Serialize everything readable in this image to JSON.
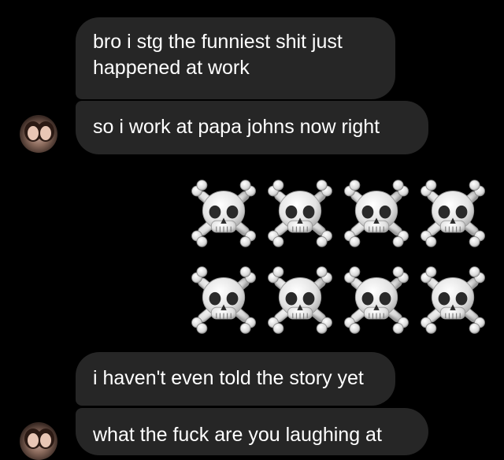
{
  "messages": [
    {
      "text": "bro i stg the funniest shit just\nhappened at work"
    },
    {
      "text": "so i work at papa johns now right"
    },
    {
      "text": "i haven't even told the story yet"
    },
    {
      "text": "what the fuck are you laughing at"
    }
  ],
  "reaction": {
    "icon": "skull-and-crossbones-icon",
    "count": 8,
    "rows": 2,
    "per_row": 4
  },
  "colors": {
    "background": "#000000",
    "bubble": "#262626",
    "text": "#ffffff"
  }
}
